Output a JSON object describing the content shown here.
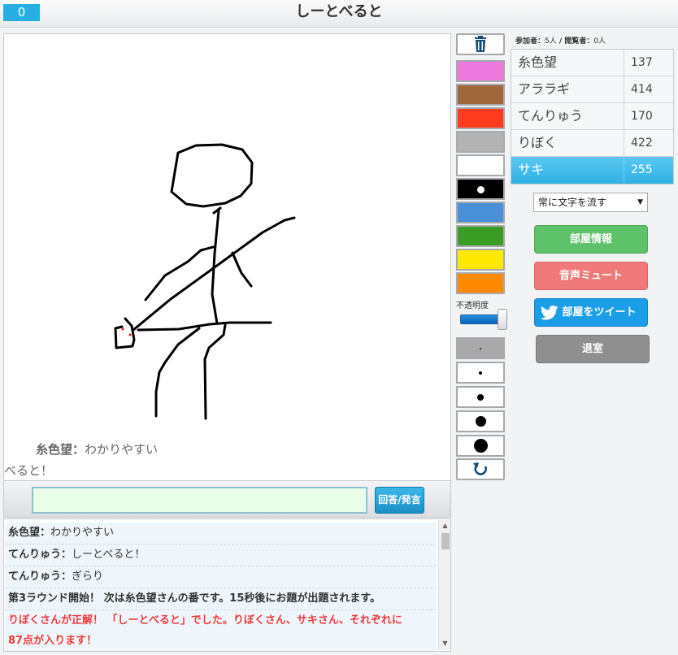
{
  "header": {
    "timer": "0",
    "title": "しーとべると"
  },
  "canvas": {
    "overlay_messages": [
      {
        "name": "糸色望",
        "text": "わかりやすい"
      },
      {
        "name": "",
        "text": "べると！"
      }
    ]
  },
  "input": {
    "value": "",
    "submit_label": "回答/発言"
  },
  "chat": [
    {
      "name": "糸色望",
      "text": "わかりやすい",
      "kind": "user"
    },
    {
      "name": "てんりゅう",
      "text": "しーとべると！",
      "kind": "user"
    },
    {
      "name": "てんりゅう",
      "text": "ぎらり",
      "kind": "user"
    },
    {
      "name": "",
      "text": "第3ラウンド開始！ 次は糸色望さんの番です。15秒後にお題が出題されます。",
      "kind": "system"
    },
    {
      "name": "",
      "text": "りぼくさんが正解！ 「しーとべると」でした。りぼくさん、サキさん、それぞれに",
      "kind": "correct"
    },
    {
      "name": "",
      "text": "87点が入ります！",
      "kind": "correct"
    }
  ],
  "palette": {
    "colors": [
      "#ee7ae0",
      "#a0663c",
      "#ff3b1e",
      "#b3b3b3",
      "#ffffff",
      "#000000",
      "#4a90d9",
      "#3a9b25",
      "#ffe900",
      "#ff8a00"
    ],
    "selected_index": 5,
    "opacity_label": "不透明度",
    "opacity_value": 1.0
  },
  "tools": {
    "clear_icon": "trash-icon",
    "undo_icon": "undo-icon"
  },
  "brush_sizes": {
    "count": 5,
    "selected_index": 0
  },
  "room": {
    "participants_label": "参加者：",
    "participants_count": "5人",
    "separator": " / ",
    "viewers_label": "閲覧者：",
    "viewers_count": "0人"
  },
  "ranking": [
    {
      "name": "糸色望",
      "score": "137",
      "current": false
    },
    {
      "name": "アララギ",
      "score": "414",
      "current": false
    },
    {
      "name": "てんりゅう",
      "score": "170",
      "current": false
    },
    {
      "name": "りぼく",
      "score": "422",
      "current": false
    },
    {
      "name": "サキ",
      "score": "255",
      "current": true
    }
  ],
  "controls": {
    "scroll_mode": "常に文字を流す",
    "room_info": "部屋情報",
    "mute": "音声ミュート",
    "tweet": "部屋をツイート",
    "leave": "退室"
  }
}
